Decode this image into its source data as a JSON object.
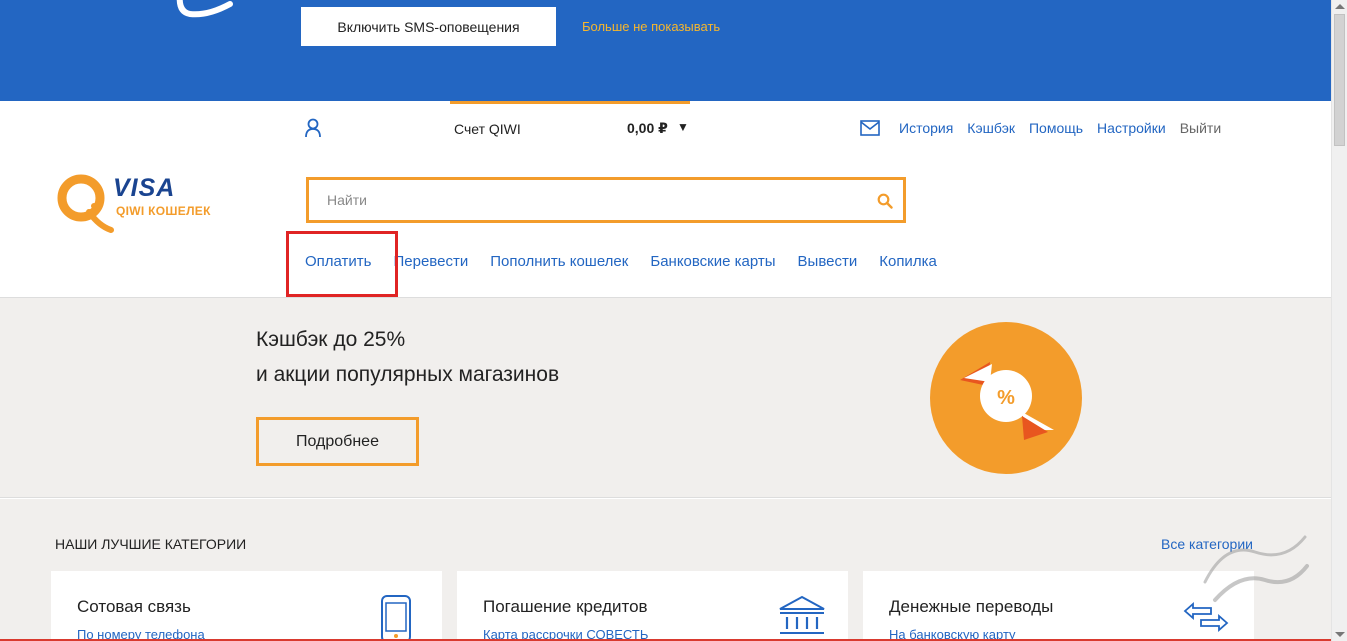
{
  "sms_banner": {
    "enable_button": "Включить SMS-оповещения",
    "dismiss_link": "Больше не показывать"
  },
  "account": {
    "label": "Счет QIWI",
    "balance": "0,00 ₽",
    "dropdown_arrow": "▼"
  },
  "top_links": {
    "history": "История",
    "cashback": "Кэшбэк",
    "help": "Помощь",
    "settings": "Настройки",
    "logout": "Выйти"
  },
  "logo": {
    "visa": "VISA",
    "subtitle": "QIWI КОШЕЛЕК"
  },
  "search": {
    "placeholder": "Найти"
  },
  "main_nav": {
    "items": [
      {
        "label": "Оплатить"
      },
      {
        "label": "Перевести"
      },
      {
        "label": "Пополнить кошелек"
      },
      {
        "label": "Банковские карты"
      },
      {
        "label": "Вывести"
      },
      {
        "label": "Копилка"
      }
    ]
  },
  "promo": {
    "line1": "Кэшбэк до 25%",
    "line2": "и акции популярных магазинов",
    "button": "Подробнее"
  },
  "categories": {
    "heading": "НАШИ ЛУЧШИЕ КАТЕГОРИИ",
    "all_link": "Все категории",
    "cards": [
      {
        "title": "Сотовая связь",
        "subtitle": "По номеру телефона",
        "icon": "phone-icon"
      },
      {
        "title": "Погашение кредитов",
        "subtitle": "Карта рассрочки СОВЕСТЬ",
        "icon": "bank-icon"
      },
      {
        "title": "Денежные переводы",
        "subtitle": "На банковскую карту",
        "icon": "transfer-arrows-icon"
      }
    ]
  },
  "colors": {
    "banner_blue": "#2366c2",
    "accent_orange": "#f39c2b",
    "link_blue": "#2366c2",
    "highlight_red": "#e02424",
    "promo_bg": "#f1efed"
  }
}
